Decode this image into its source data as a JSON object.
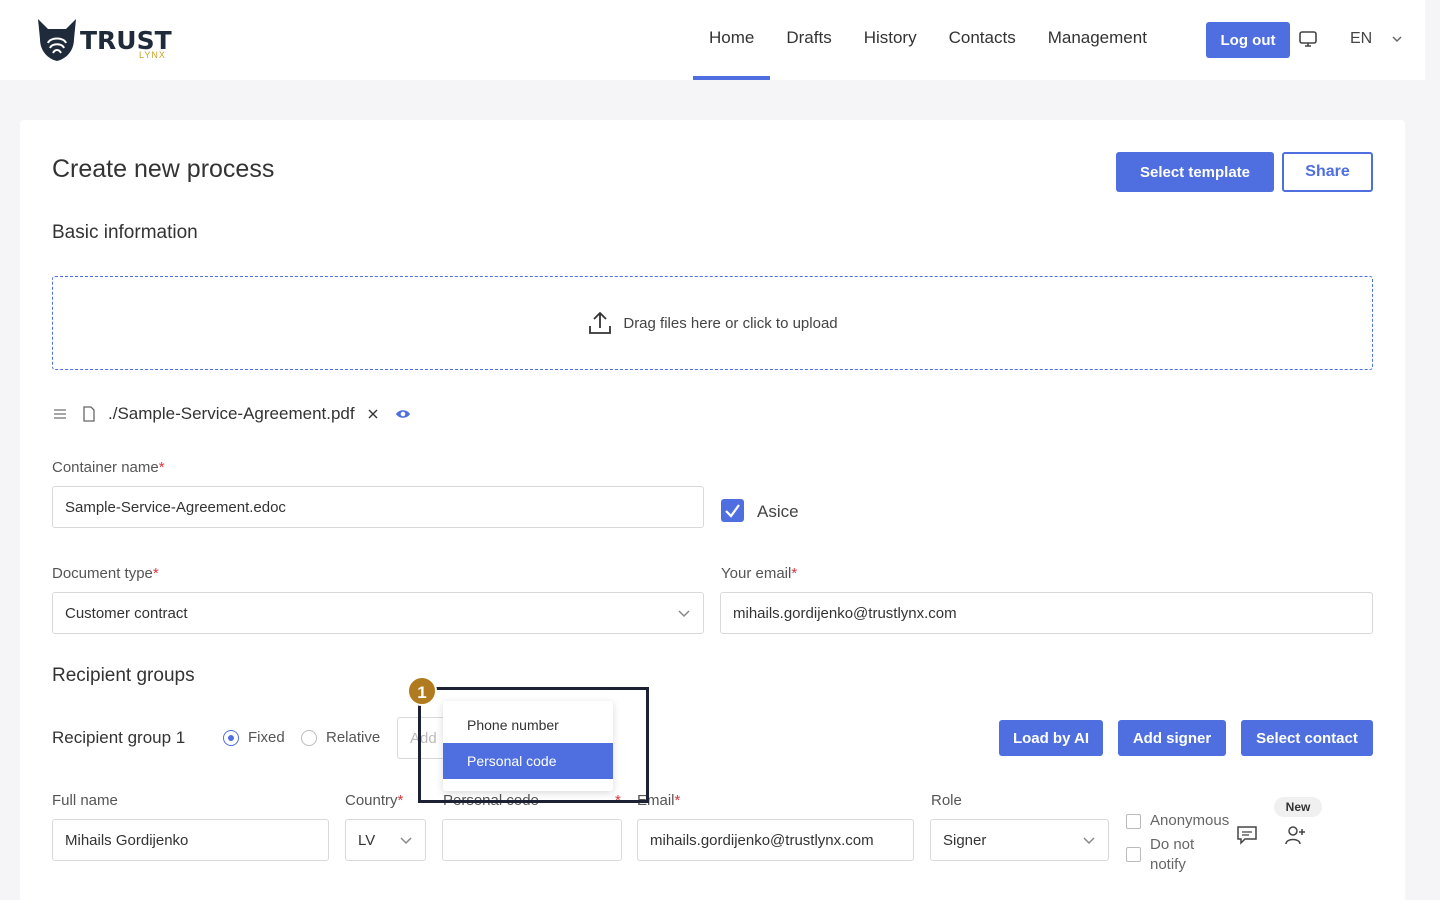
{
  "header": {
    "logo_text": "TRUST",
    "logo_sub": "LYNX",
    "nav": [
      "Home",
      "Drafts",
      "History",
      "Contacts",
      "Management"
    ],
    "active_nav": "Home",
    "logout_label": "Log out",
    "language": "EN",
    "colors": {
      "accent": "#4f6fe0"
    }
  },
  "page": {
    "title": "Create new process",
    "select_template_label": "Select template",
    "share_label": "Share"
  },
  "basic_info": {
    "title": "Basic information",
    "upload_text": "Drag files here or click to upload",
    "file_name": "./Sample-Service-Agreement.pdf",
    "container_name_label": "Container name",
    "container_name_value": "Sample-Service-Agreement.edoc",
    "asice_label": "Asice",
    "asice_checked": true,
    "document_type_label": "Document type",
    "document_type_value": "Customer contract",
    "your_email_label": "Your email",
    "your_email_value": "mihails.gordijenko@trustlynx.com",
    "required_mark": "*"
  },
  "recipients": {
    "title": "Recipient groups",
    "group_label": "Recipient group 1",
    "fixed_label": "Fixed",
    "relative_label": "Relative",
    "add_placeholder": "Add",
    "load_ai_label": "Load by AI",
    "add_signer_label": "Add signer",
    "select_contact_label": "Select contact",
    "full_name_label": "Full name",
    "full_name_value": "Mihails Gordijenko",
    "country_label": "Country",
    "country_value": "LV",
    "personal_code_label": "Personal code",
    "email_label": "Email",
    "email_value": "mihails.gordijenko@trustlynx.com",
    "role_label": "Role",
    "role_value": "Signer",
    "anonymous_label": "Anonymous",
    "do_not_notify_label": "Do not notify",
    "new_badge": "New"
  },
  "dropdown": {
    "options": [
      "Phone number",
      "Personal code"
    ],
    "selected": "Personal code",
    "step_number": "1"
  }
}
